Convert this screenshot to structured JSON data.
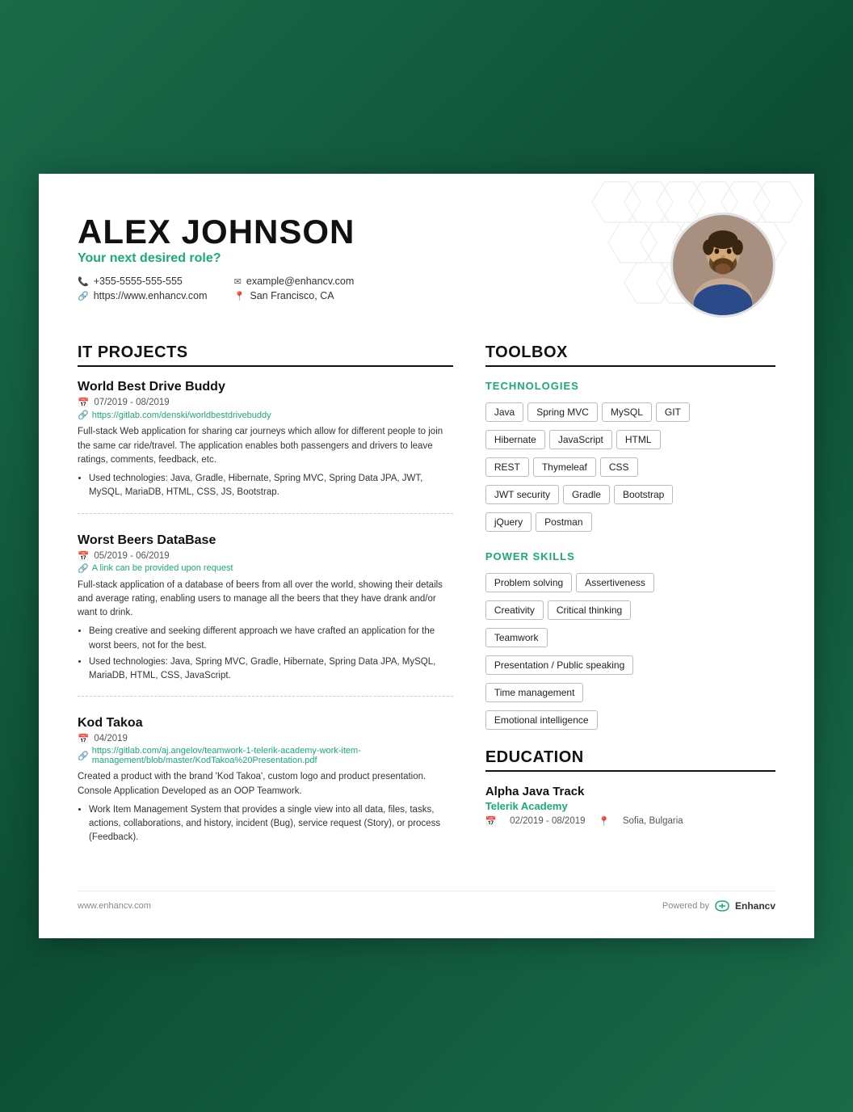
{
  "header": {
    "name": "ALEX JOHNSON",
    "role": "Your next desired role?",
    "phone": "+355-5555-555-555",
    "website": "https://www.enhancv.com",
    "email": "example@enhancv.com",
    "location": "San Francisco, CA"
  },
  "sections": {
    "it_projects": {
      "title": "IT PROJECTS",
      "projects": [
        {
          "name": "World Best Drive Buddy",
          "date": "07/2019 - 08/2019",
          "link": "https://gitlab.com/denski/worldbestdrivebuddy",
          "description": "Full-stack Web application for sharing car journeys which allow for different people to join the same car ride/travel. The application enables both passengers and drivers to leave ratings, comments, feedback, etc.",
          "bullets": [
            "Used technologies: Java, Gradle, Hibernate, Spring MVC, Spring Data JPA, JWT, MySQL, MariaDB, HTML, CSS, JS, Bootstrap."
          ]
        },
        {
          "name": "Worst Beers DataBase",
          "date": "05/2019 - 06/2019",
          "link": "A link can be provided upon request",
          "description": "Full-stack application of a database of beers from all over the world, showing their details and average rating, enabling users to manage all the beers that they have drank and/or want to drink.",
          "bullets": [
            "Being creative and seeking different approach we have crafted an application for the worst beers, not for the best.",
            "Used technologies: Java, Spring MVC, Gradle, Hibernate, Spring Data JPA, MySQL, MariaDB, HTML, CSS, JavaScript."
          ]
        },
        {
          "name": "Kod Takoa",
          "date": "04/2019",
          "link": "https://gitlab.com/aj.angelov/teamwork-1-telerik-academy-work-item-management/blob/master/KodTakoa%20Presentation.pdf",
          "description": "Created a product with the brand 'Kod Takoa', custom logo and product presentation. Console Application Developed as an OOP Teamwork.",
          "bullets": [
            "Work Item Management System that provides a single view into all data, files, tasks, actions, collaborations, and history, incident (Bug), service request (Story), or process (Feedback)."
          ]
        }
      ]
    },
    "toolbox": {
      "title": "TOOLBOX",
      "technologies": {
        "subtitle": "TECHNOLOGIES",
        "tags": [
          "Java",
          "Spring MVC",
          "MySQL",
          "GIT",
          "Hibernate",
          "JavaScript",
          "HTML",
          "REST",
          "Thymeleaf",
          "CSS",
          "JWT security",
          "Gradle",
          "Bootstrap",
          "jQuery",
          "Postman"
        ]
      },
      "power_skills": {
        "subtitle": "POWER SKILLS",
        "tags": [
          "Problem solving",
          "Assertiveness",
          "Creativity",
          "Critical thinking",
          "Teamwork",
          "Presentation / Public speaking",
          "Time management",
          "Emotional intelligence"
        ]
      }
    },
    "education": {
      "title": "EDUCATION",
      "items": [
        {
          "name": "Alpha Java Track",
          "institution": "Telerik Academy",
          "date": "02/2019 - 08/2019",
          "location": "Sofia, Bulgaria"
        }
      ]
    }
  },
  "footer": {
    "website": "www.enhancv.com",
    "powered_by": "Powered by",
    "brand": "Enhancv"
  }
}
